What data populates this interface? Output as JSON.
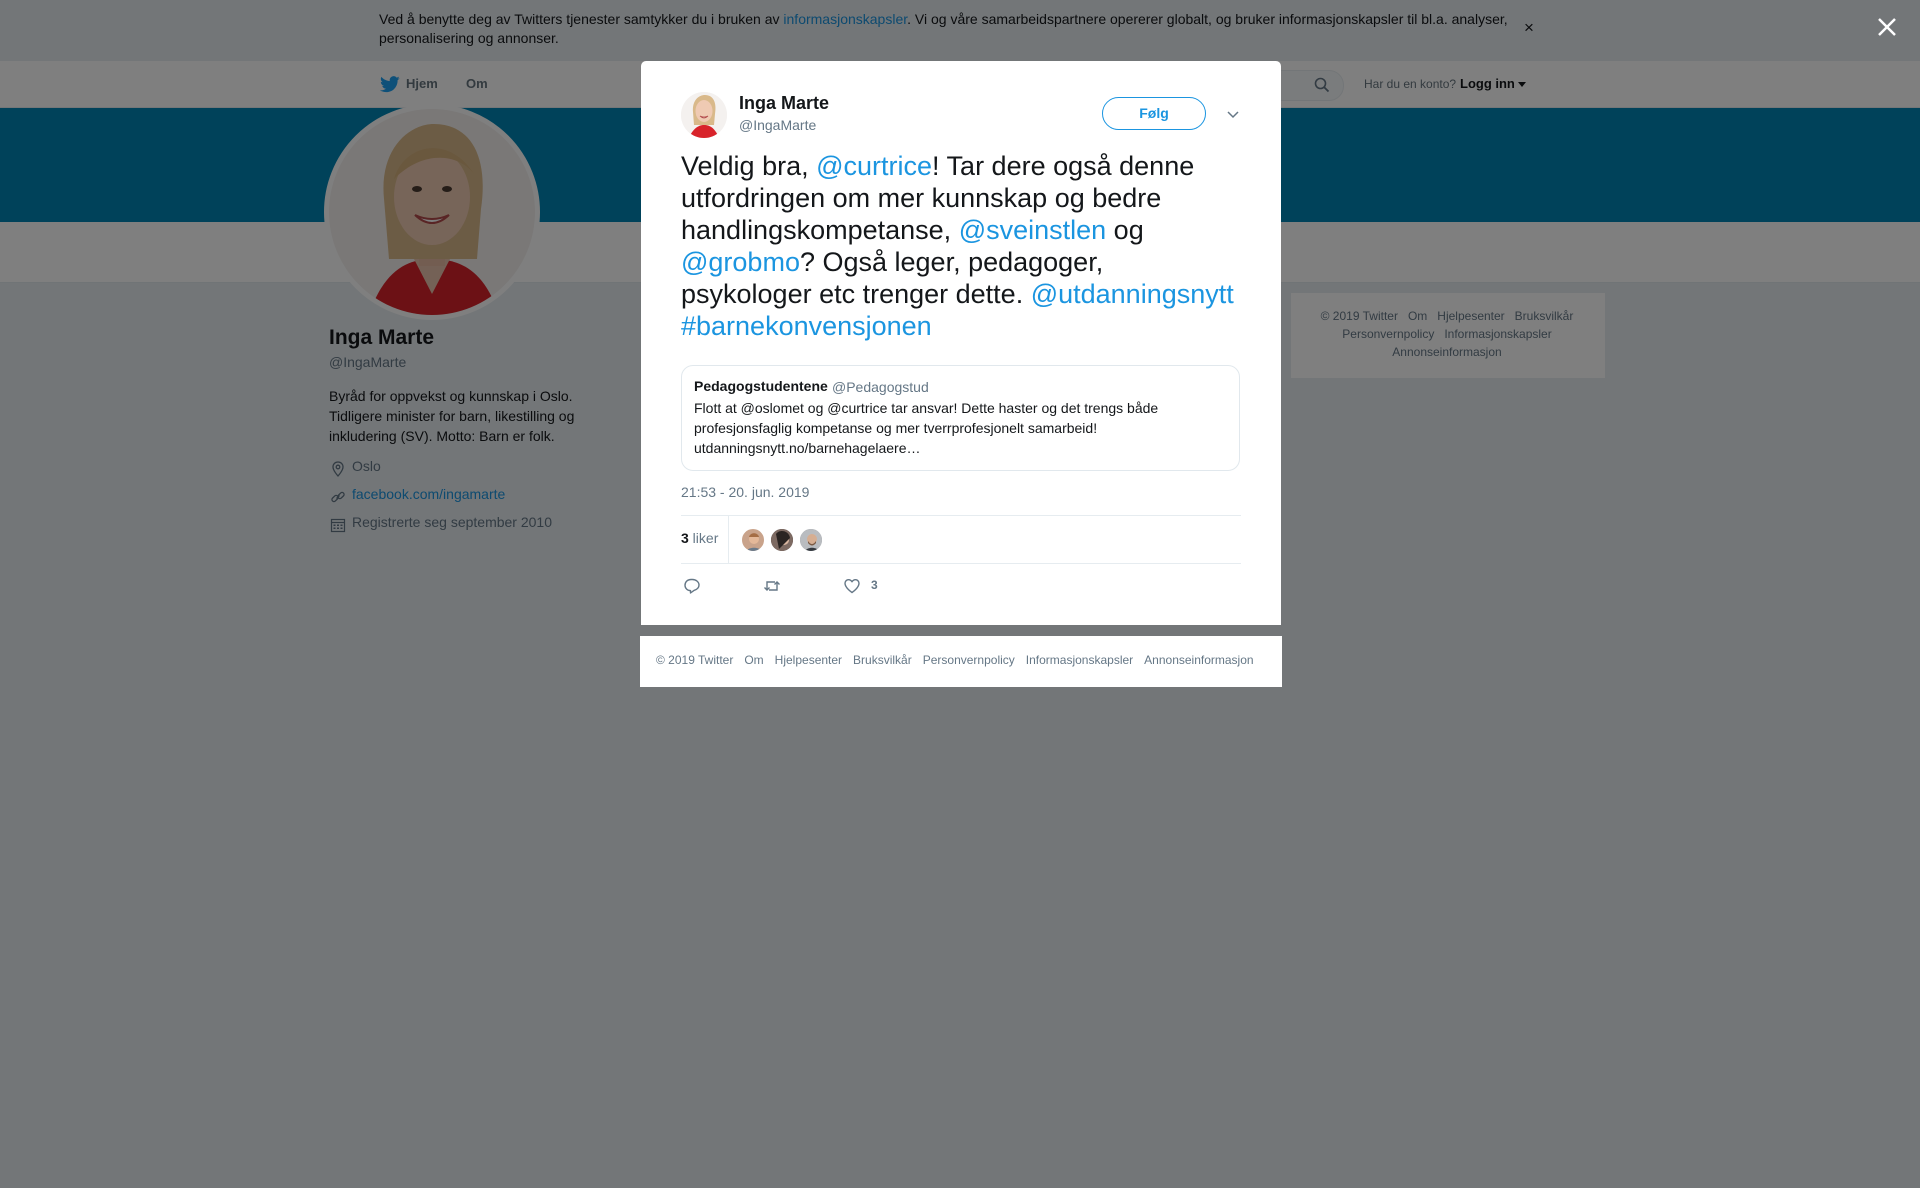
{
  "cookie_banner": {
    "text_before": "Ved å benytte deg av Twitters tjenester samtykker du i bruken av ",
    "link": "informasjonskapsler",
    "text_after": ". Vi og våre samarbeidspartnere opererer globalt, og bruker informasjonskapsler til bl.a. analyser, personalisering og annonser.",
    "close": "×"
  },
  "topnav": {
    "home": "Hjem",
    "about": "Om",
    "account_question": "Har du en konto?",
    "login": "Logg inn"
  },
  "profile": {
    "name": "Inga Marte",
    "handle": "@IngaMarte",
    "bio": "Byråd for oppvekst og kunnskap i Oslo. Tidligere minister for barn, likestilling og inkludering (SV). Motto: Barn er folk.",
    "location": "Oslo",
    "link": "facebook.com/ingamarte",
    "joined": "Registrerte seg september 2010"
  },
  "side_footer": {
    "items": [
      "© 2019 Twitter",
      "Om",
      "Hjelpesenter",
      "Bruksvilkår",
      "Personvernpolicy",
      "Informasjonskapsler",
      "Annonseinformasjon"
    ]
  },
  "tweet": {
    "author_name": "Inga Marte",
    "author_handle": "@IngaMarte",
    "follow_label": "Følg",
    "text": {
      "t1": "Veldig bra, ",
      "m1": "@curtrice",
      "t2": "! Tar dere også denne utfordringen om mer kunnskap og bedre handlingskompetanse, ",
      "m2": "@sveinstlen",
      "t3": " og ",
      "m3": "@grobmo",
      "t4": "? Også leger, pedagoger, psykologer etc trenger dette. ",
      "m4": "@utdanningsnytt",
      "t5": " ",
      "m5": "#barnekonvensjonen"
    },
    "quote": {
      "name": "Pedagogstudentene",
      "handle": "@Pedagogstud",
      "text": "Flott at @oslomet og @curtrice tar ansvar! Dette haster og det trengs både profesjonsfaglig kompetanse og mer tverrprofesjonelt samarbeid! utdanningsnytt.no/barnehagelaere…"
    },
    "timestamp": "21:53 - 20. jun. 2019",
    "likes_count": "3",
    "likes_label": " liker",
    "like_action_count": "3"
  },
  "modal_footer": {
    "items": [
      "© 2019 Twitter",
      "Om",
      "Hjelpesenter",
      "Bruksvilkår",
      "Personvernpolicy",
      "Informasjonskapsler",
      "Annonseinformasjon"
    ]
  },
  "colors": {
    "twitter_blue": "#1b95e0",
    "banner_blue": "#0084b4",
    "like_heart": "#657786",
    "overlay": "rgba(0,0,0,0.5)"
  },
  "icons": [
    "twitter-bird-icon",
    "search-icon",
    "location-icon",
    "link-icon",
    "calendar-icon",
    "close-icon",
    "chevron-down-icon",
    "reply-icon",
    "retweet-icon",
    "like-icon"
  ]
}
